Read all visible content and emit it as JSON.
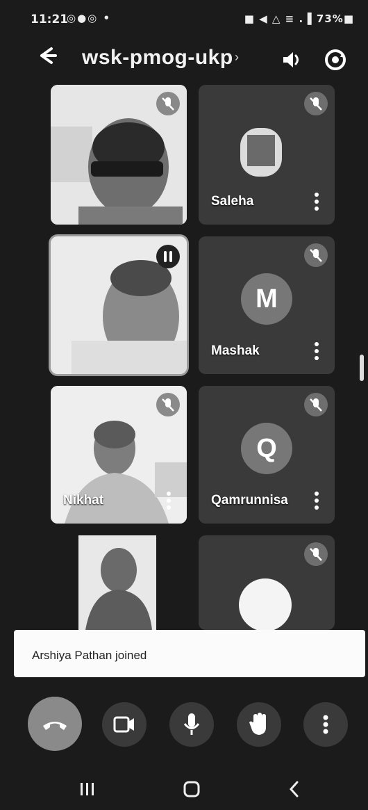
{
  "status_bar": {
    "time": "11:21",
    "notifications": "◎●◎ •",
    "system": "■ ◀ △ ≡ .▐ 73%■"
  },
  "header": {
    "meeting_code": "wsk-pmog-ukp",
    "chevron": "›"
  },
  "participants": [
    {
      "name": "",
      "type": "video",
      "muted": true
    },
    {
      "name": "Saleha",
      "type": "video-small",
      "muted": true
    },
    {
      "name": "",
      "type": "video",
      "speaking": true
    },
    {
      "name": "Mashak",
      "type": "avatar",
      "initial": "M",
      "muted": true
    },
    {
      "name": "Nikhat",
      "type": "video",
      "muted": true
    },
    {
      "name": "Qamrunnisa",
      "type": "avatar",
      "initial": "Q",
      "muted": true
    },
    {
      "name": "",
      "type": "video",
      "muted": false
    },
    {
      "name": "",
      "type": "avatar-loading",
      "muted": true
    }
  ],
  "toast": {
    "message": "Arshiya Pathan joined"
  },
  "controls": [
    "end-call",
    "camera",
    "microphone",
    "raise-hand",
    "more-options"
  ],
  "colors": {
    "background": "#1b1b1b",
    "tile": "#3a3a3a",
    "control": "#3a3a3a",
    "end_call": "#8a8a8a"
  }
}
